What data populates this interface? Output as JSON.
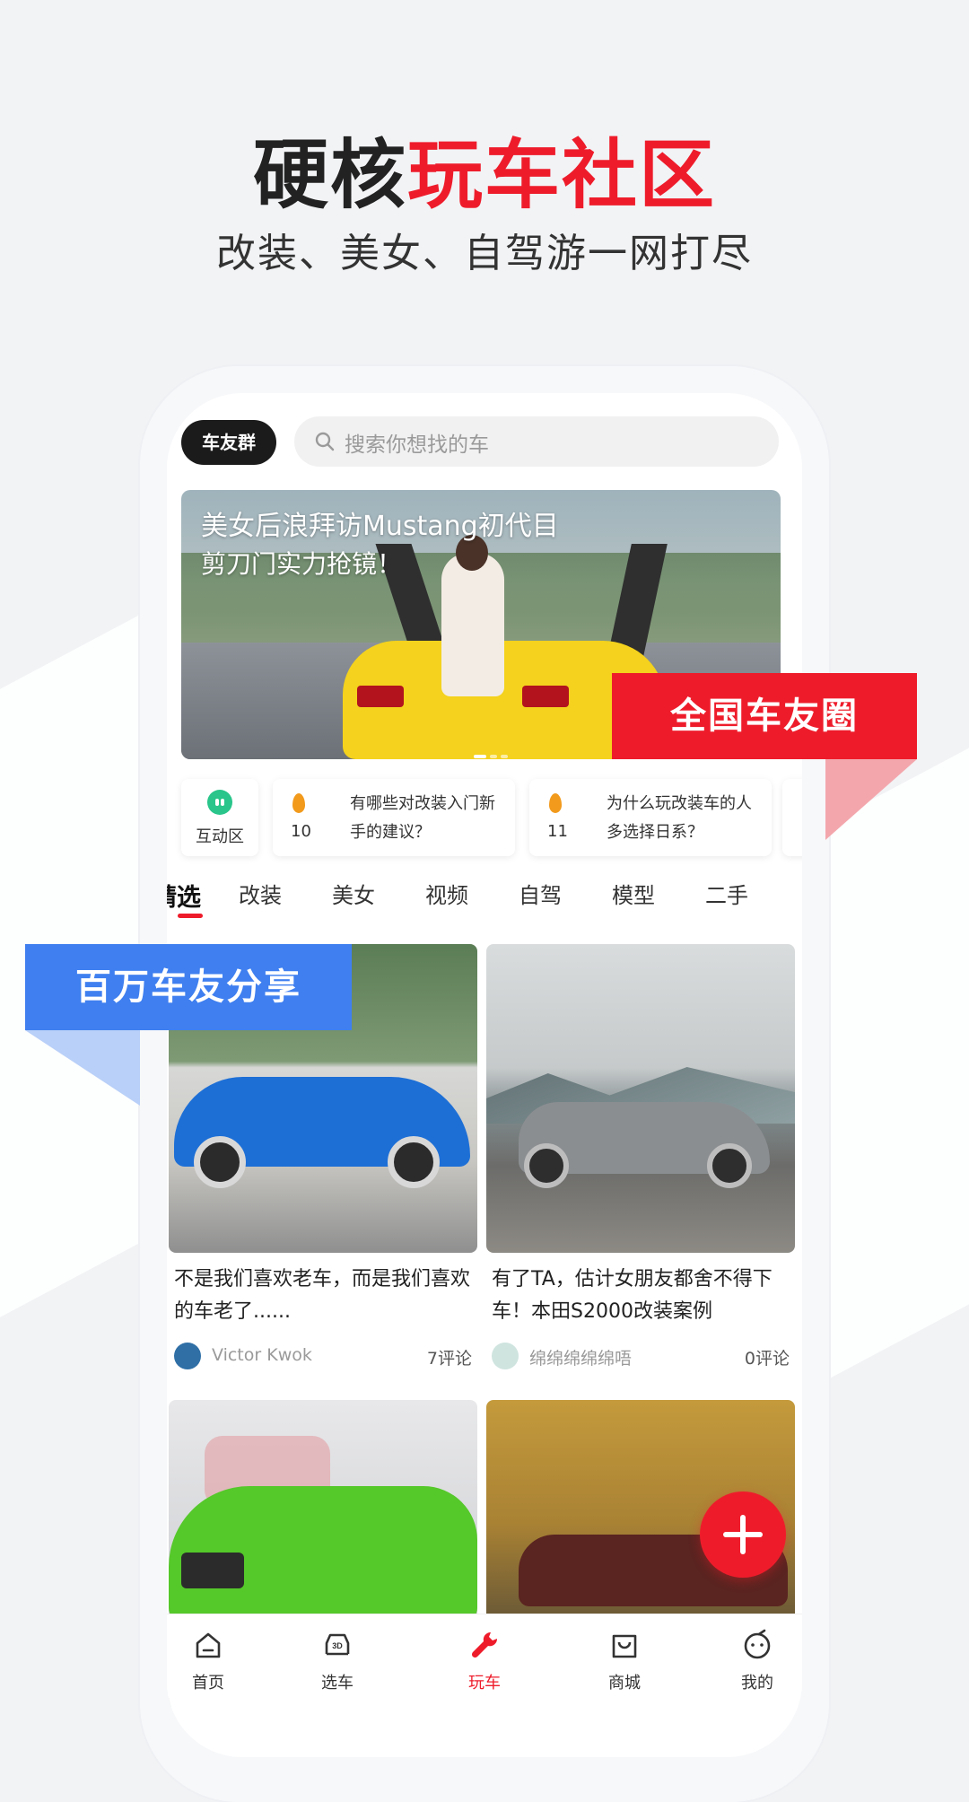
{
  "hero": {
    "title_dark": "硬核",
    "title_red": "玩车社区",
    "subtitle": "改装、美女、自驾游一网打尽"
  },
  "header": {
    "group_button": "车友群",
    "search_placeholder": "搜索你想找的车"
  },
  "banner": {
    "line1": "美女后浪拜访Mustang初代目",
    "line2": "剪刀门实力抢镜！"
  },
  "quick": {
    "interaction_label": "互动区",
    "cards": [
      {
        "num": "10",
        "text": "有哪些对改装入门新手的建议？"
      },
      {
        "num": "11",
        "text": "为什么玩改装车的人多选择日系？"
      }
    ]
  },
  "tabs": [
    "精选",
    "改装",
    "美女",
    "视频",
    "自驾",
    "模型",
    "二手"
  ],
  "posts": [
    {
      "title": "不是我们喜欢老车，而是我们喜欢的车老了......",
      "author": "Victor Kwok",
      "comments": "7评论"
    },
    {
      "title": "有了TA，估计女朋友都舍不得下车！本田S2000改装案例",
      "author": "绵绵绵绵绵唔",
      "comments": "0评论"
    }
  ],
  "badges": {
    "red": "全国车友圈",
    "blue": "百万车友分享"
  },
  "nav": [
    "首页",
    "选车",
    "玩车",
    "商城",
    "我的"
  ],
  "nav_active": "玩车",
  "colors": {
    "accent": "#ee1c2b",
    "blue_badge": "#3f7ff0"
  }
}
